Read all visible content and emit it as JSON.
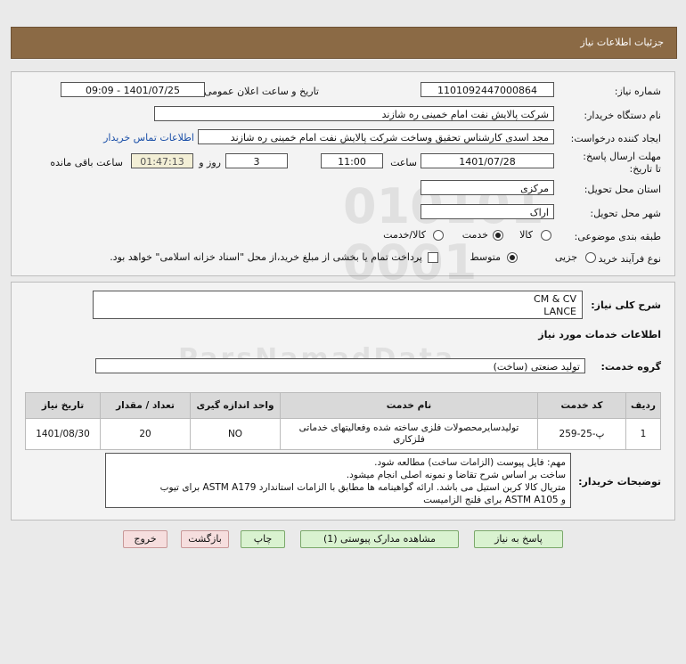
{
  "header": {
    "title": "جزئیات اطلاعات نیاز"
  },
  "form": {
    "need_number_label": "شماره نیاز:",
    "need_number": "1101092447000864",
    "announce_label": "تاریخ و ساعت اعلان عمومی:",
    "announce_value": "1401/07/25 - 09:09",
    "buyer_org_label": "نام دستگاه خریدار:",
    "buyer_org": "شرکت پالایش نفت امام خمینی  ره  شازند",
    "creator_label": "ایجاد کننده درخواست:",
    "creator": "مجد اسدی کارشناس تحقیق وساخت شرکت پالایش نفت امام خمینی  ره  شازند",
    "contact_link": "اطلاعات تماس خریدار",
    "deadline_label": "مهلت ارسال پاسخ: تا تاریخ:",
    "deadline_date": "1401/07/28",
    "time_label": "ساعت",
    "deadline_time": "11:00",
    "days_value": "3",
    "days_label": "روز و",
    "remaining_time": "01:47:13",
    "remaining_label": "ساعت باقی مانده",
    "province_label": "استان محل تحویل:",
    "province": "مرکزی",
    "city_label": "شهر محل تحویل:",
    "city": "اراک",
    "category_label": "طبقه بندی موضوعی:",
    "category_options": [
      "کالا",
      "خدمت",
      "کالا/خدمت"
    ],
    "category_selected": 1,
    "process_label": "نوع فرآیند خرید :",
    "process_options": [
      "جزیی",
      "متوسط"
    ],
    "process_selected": 1,
    "payment_note": "پرداخت تمام یا بخشی از مبلغ خرید،از محل \"اسناد خزانه اسلامی\" خواهد بود."
  },
  "summary": {
    "label": "شرح کلی نیاز:",
    "line1": "CM & CV",
    "line2": "LANCE"
  },
  "services": {
    "section_title": "اطلاعات خدمات مورد نیاز",
    "group_label": "گروه خدمت:",
    "group_value": "تولید صنعتی (ساخت)"
  },
  "table": {
    "headers": [
      "ردیف",
      "کد خدمت",
      "نام خدمت",
      "واحد اندازه گیری",
      "تعداد / مقدار",
      "تاریخ نیاز"
    ],
    "rows": [
      [
        "1",
        "پ-25-259",
        "تولیدسایرمحصولات فلزی ساخته شده وفعالیتهای خدماتی فلزکاری",
        "NO",
        "20",
        "1401/08/30"
      ]
    ]
  },
  "notes": {
    "label": "توضیحات خریدار:",
    "line1": "مهم: فایل پیوست (الزامات ساخت) مطالعه شود.",
    "line2": "ساخت بر اساس شرح تقاضا و نمونه اصلی انجام میشود.",
    "line3": "متریال کالا کربن استیل می باشد. ارائه گواهینامه ها مطابق با الزامات استاندارد ASTM A179 برای تیوب",
    "line4": "و ASTM A105 برای فلنج الزامیست"
  },
  "buttons": {
    "reply": "پاسخ به نیاز",
    "attachments": "مشاهده مدارک پیوستی (1)",
    "print": "چاپ",
    "back": "بازگشت",
    "exit": "خروج"
  }
}
